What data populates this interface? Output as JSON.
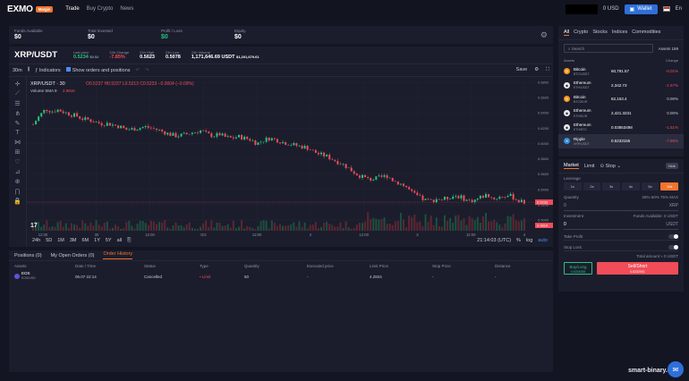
{
  "header": {
    "logo": "EXMO",
    "logo_badge": "Margin",
    "nav": [
      "Trade",
      "Buy Crypto",
      "News"
    ],
    "balance": "0 USD",
    "wallet_label": "Wallet",
    "language": "En"
  },
  "stats": [
    {
      "label": "Funds Available",
      "value": "$0"
    },
    {
      "label": "Total Invested",
      "value": "$0"
    },
    {
      "label": "Profit / Loss",
      "value": "$0"
    },
    {
      "label": "Equity",
      "value": "$0"
    }
  ],
  "ticker": {
    "pair": "XRP/USDT",
    "items": [
      {
        "label": "Last price",
        "value": "0.5234",
        "extra": "$0.52"
      },
      {
        "label": "24h Change",
        "value": "-7.85%"
      },
      {
        "label": "24h High",
        "value": "0.5623"
      },
      {
        "label": "24h Low",
        "value": "0.5078"
      },
      {
        "label": "24h Volume",
        "value": "1,171,646.69 USDT",
        "extra": "$1,201,679.61"
      }
    ]
  },
  "toolbar": {
    "interval": "30m",
    "indicators": "Indicators",
    "show_orders": "Show orders and positions",
    "save": "Save"
  },
  "chart_header": {
    "symbol": "XRP/USDT · 30",
    "ohlc": "O0.5237 H0.5237 L0.5213 C0.5233 −0.0004 (−0.09%)",
    "volume": "Volume SMA 9",
    "volume_value": "2.981K"
  },
  "chart_data": {
    "type": "candlestick",
    "y_ticks": [
      "0.6800",
      "0.6600",
      "0.6400",
      "0.6200",
      "0.6000",
      "0.5800",
      "0.5600",
      "0.5400",
      "0.5200",
      "0.5000"
    ],
    "x_ticks": [
      "12:00",
      "30",
      "12:00",
      "Oct",
      "12:00",
      "2",
      "12:00",
      "3",
      "12:00",
      "4"
    ],
    "last_price_label": "0.5233",
    "volume_label": "2.981K",
    "ylim": [
      0.5,
      0.68
    ],
    "close_path": [
      0.625,
      0.636,
      0.645,
      0.642,
      0.644,
      0.641,
      0.638,
      0.636,
      0.632,
      0.631,
      0.628,
      0.626,
      0.626,
      0.624,
      0.622,
      0.618,
      0.619,
      0.62,
      0.622,
      0.62,
      0.618,
      0.615,
      0.612,
      0.61,
      0.611,
      0.613,
      0.615,
      0.617,
      0.612,
      0.61,
      0.612,
      0.608,
      0.607,
      0.609,
      0.607,
      0.605,
      0.6,
      0.604,
      0.607,
      0.605,
      0.602,
      0.6,
      0.598,
      0.596,
      0.595,
      0.59,
      0.586,
      0.584,
      0.58,
      0.576,
      0.572,
      0.566,
      0.56,
      0.556,
      0.553,
      0.554,
      0.556,
      0.558,
      0.551,
      0.548,
      0.543,
      0.535,
      0.53,
      0.526,
      0.525,
      0.528,
      0.527,
      0.53,
      0.532,
      0.529,
      0.525,
      0.526,
      0.53,
      0.533,
      0.528,
      0.53,
      0.532,
      0.531,
      0.525,
      0.523
    ]
  },
  "timeframes": [
    "24h",
    "5D",
    "1M",
    "3M",
    "6M",
    "1Y",
    "5Y",
    "all"
  ],
  "chart_status": {
    "time": "21:14:03 (UTC)",
    "percent": "%",
    "log": "log",
    "auto": "auto"
  },
  "orders": {
    "tabs": [
      "Positions (0)",
      "My Open Orders (0)",
      "Order History"
    ],
    "columns": [
      "Assets",
      "Date / Time",
      "Status",
      "Type",
      "Quantity",
      "Executed price",
      "Limit Price",
      "Stop Price",
      "Distance"
    ],
    "rows": [
      {
        "asset": "EOS",
        "asset_sub": "EOS/USD",
        "date": "06.07 22:14",
        "status": "Cancelled",
        "type": "• Limit",
        "quantity": "50",
        "executed": "-",
        "limit": "4.2824",
        "stop": "-",
        "distance": "-"
      }
    ]
  },
  "markets": {
    "tabs": [
      "All",
      "Crypto",
      "Stocks",
      "Indices",
      "Commodities"
    ],
    "search_placeholder": "Search",
    "assets_count": "Assets 169",
    "columns": [
      "Assets",
      "Change"
    ],
    "rows": [
      {
        "name": "Bitcoin",
        "sub": "BTC/USDT",
        "price": "60,791.57",
        "change": "-0.01%",
        "icon_color": "#f7931a",
        "icon": "₿",
        "change_color": "#f14c57"
      },
      {
        "name": "Ethereum",
        "sub": "ETH/USDT",
        "price": "2,342.73",
        "change": "-1.57%",
        "icon_color": "#e8e9ee",
        "icon": "◆",
        "change_color": "#f14c57"
      },
      {
        "name": "Bitcoin",
        "sub": "BTC/EUR",
        "price": "62,153.4",
        "change": "0.00%",
        "icon_color": "#f7931a",
        "icon": "₿",
        "change_color": "#c8cbd6"
      },
      {
        "name": "Ethereum",
        "sub": "ETH/EUR",
        "price": "2,421.3231",
        "change": "0.00%",
        "icon_color": "#e8e9ee",
        "icon": "◆",
        "change_color": "#c8cbd6"
      },
      {
        "name": "Ethereum",
        "sub": "ETH/BTC",
        "price": "0.03853498",
        "change": "-1.51%",
        "icon_color": "#e8e9ee",
        "icon": "◆",
        "change_color": "#f14c57"
      },
      {
        "name": "Ripple",
        "sub": "XRP/USDT",
        "price": "0.5233155",
        "change": "-7.85%",
        "icon_color": "#2f8fd9",
        "icon": "✕",
        "change_color": "#f14c57"
      }
    ]
  },
  "trade": {
    "tabs": [
      "Market",
      "Limit",
      "Stop"
    ],
    "hide": "Hide",
    "leverage_label": "Leverage",
    "leverage": [
      "1x",
      "2x",
      "3x",
      "4x",
      "5x",
      "10x"
    ],
    "quantity_label": "Quantity",
    "quantity_pcts": "25% 50% 75% MAX",
    "quantity_value": "0",
    "quantity_unit": "XRP",
    "investment_label": "Investment",
    "funds_available": "Funds Available: 0 USDT",
    "investment_value": "0",
    "investment_unit": "USDT",
    "take_profit": "Take Profit",
    "stop_loss": "Stop Loss",
    "total": "Total amount ≈ 0 USDT",
    "buy_label": "Buy/Long",
    "buy_price": "0.5234088",
    "sell_label": "Sell/Short",
    "sell_price": "0.5232901"
  },
  "watermark": "smart-binary.com"
}
